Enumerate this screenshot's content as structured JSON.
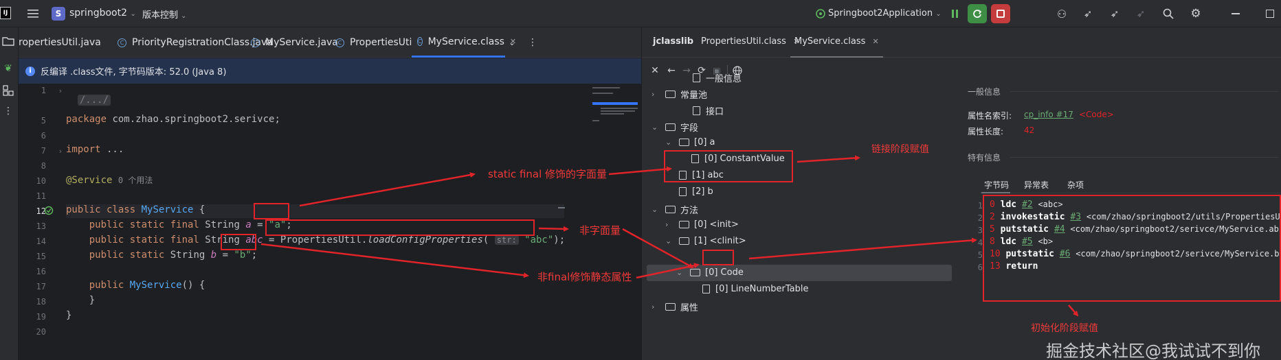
{
  "titlebar": {
    "project_badge": "S",
    "project_name": "springboot2",
    "vcs_label": "版本控制",
    "run_config": "Springboot2Application"
  },
  "tabs": [
    {
      "label": "ropertiesUtil.java"
    },
    {
      "label": "PriorityRegistrationClass.java"
    },
    {
      "label": "MyService.java"
    },
    {
      "label": "PropertiesUtil.class"
    },
    {
      "label": "MyService.class",
      "close": "✕"
    }
  ],
  "infobar": {
    "text": "反编译 .class文件, 字节码版本: 52.0 (Java 8)"
  },
  "code": {
    "line_numbers": [
      "1",
      "5",
      "6",
      "7",
      "8",
      "10",
      "11",
      "12",
      "13",
      "14",
      "15",
      "16",
      "17",
      "18",
      "19",
      "20"
    ],
    "l1": "/.../",
    "l6_kw": "package",
    "l6_rest": " com.zhao.springboot2.serivce;",
    "l8_kw": "import",
    "l8_rest": " ...",
    "l11_ann": "@Service",
    "l11_hint": "0 个用法",
    "l12_kw": "public class",
    "l12_name": "MyService",
    "l12_rest": " {",
    "l13_kw": "public static final",
    "l13_type": " String ",
    "l13_field": "a",
    "l13_eq": " = ",
    "l13_val": "\"a\"",
    "l13_end": ";",
    "l14_kw": "public static final",
    "l14_type": " String ",
    "l14_field": "abc",
    "l14_eq": " = ",
    "l14_call": "PropertiesUtil.",
    "l14_method": "loadConfigProperties",
    "l14_paren": "(",
    "l14_hint": "str:",
    "l14_val": "\"abc\"",
    "l14_end": ");",
    "l15_kw": "public static",
    "l15_type": " String ",
    "l15_field": "b",
    "l15_eq": " = ",
    "l15_val": "\"b\"",
    "l15_end": ";",
    "l17_kw": "public",
    "l17_name": "MyService",
    "l17_rest": "() {",
    "l18": "}",
    "l19": "}"
  },
  "annotations": {
    "static_final_literal": "static final 修饰的字面量",
    "link_phase": "链接阶段赋值",
    "non_literal": "非字面量",
    "non_final_static": "非final修饰静态属性",
    "init_phase": "初始化阶段赋值"
  },
  "jclasslib": {
    "title": "jclasslib",
    "tabs": [
      "PropertiesUtil.class",
      "MyService.class"
    ],
    "tree": {
      "general": "一般信息",
      "constant_pool": "常量池",
      "interfaces": "接口",
      "fields": "字段",
      "field_a": "[0] a",
      "constant_value": "[0] ConstantValue",
      "field_abc": "[1] abc",
      "field_b": "[2] b",
      "methods": "方法",
      "method_init": "[0] <init>",
      "method_clinit_prefix": "[1]",
      "method_clinit": "<clinit>",
      "code": "[0] Code",
      "line_number_table": "[0] LineNumberTable",
      "attributes": "属性"
    },
    "details": {
      "general_header": "一般信息",
      "attr_name_label": "属性名索引:",
      "attr_name_link": "cp_info #17",
      "attr_name_value": "<Code>",
      "attr_len_label": "属性长度:",
      "attr_len_value": "42",
      "specific_header": "特有信息",
      "subtabs": [
        "字节码",
        "异常表",
        "杂项"
      ]
    },
    "bytecode": [
      {
        "ln": "1",
        "off": "0",
        "op": "ldc",
        "ref": "#2",
        "arg": "<abc>"
      },
      {
        "ln": "2",
        "off": "2",
        "op": "invokestatic",
        "ref": "#3",
        "arg": "<com/zhao/springboot2/utils/PropertiesUt"
      },
      {
        "ln": "3",
        "off": "5",
        "op": "putstatic",
        "ref": "#4",
        "arg": "<com/zhao/springboot2/serivce/MyService.abc"
      },
      {
        "ln": "4",
        "off": "8",
        "op": "ldc",
        "ref": "#5",
        "arg": "<b>"
      },
      {
        "ln": "5",
        "off": "10",
        "op": "putstatic",
        "ref": "#6",
        "arg": "<com/zhao/springboot2/serivce/MyService.b :"
      },
      {
        "ln": "6",
        "off": "13",
        "op": "return",
        "ref": "",
        "arg": ""
      }
    ]
  },
  "watermark": "掘金技术社区@我试试不到你"
}
